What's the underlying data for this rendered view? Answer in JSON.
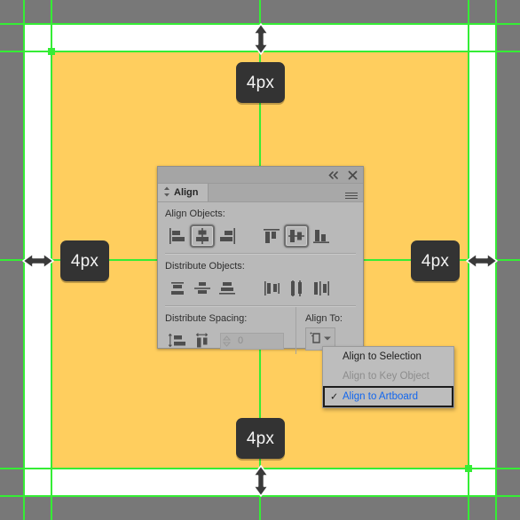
{
  "app": {
    "context": "adobe-illustrator-align-panel",
    "canvas_color": "#787878",
    "artboard_color": "#ffce5e",
    "guide_color": "#35ed35",
    "badge_color": "#333333"
  },
  "spacing_badges": [
    {
      "id": "top",
      "label": "4px"
    },
    {
      "id": "left",
      "label": "4px"
    },
    {
      "id": "right",
      "label": "4px"
    },
    {
      "id": "bottom",
      "label": "4px"
    }
  ],
  "arrows": [
    {
      "id": "top",
      "icon": "double-arrow-vertical-icon"
    },
    {
      "id": "left",
      "icon": "double-arrow-horizontal-icon"
    },
    {
      "id": "right",
      "icon": "double-arrow-horizontal-icon"
    },
    {
      "id": "bottom",
      "icon": "double-arrow-vertical-icon"
    }
  ],
  "panel": {
    "titlebar": {
      "collapse_icon": "double-chevron-left-icon",
      "close_icon": "close-icon"
    },
    "tab": {
      "label": "Align",
      "dock_icon": "up-down-arrows-icon",
      "menu_icon": "hamburger-menu-icon"
    },
    "align_objects": {
      "label": "Align Objects:",
      "buttons": [
        {
          "name": "horizontal-align-left",
          "pressed": false
        },
        {
          "name": "horizontal-align-center",
          "pressed": true
        },
        {
          "name": "horizontal-align-right",
          "pressed": false
        },
        {
          "name": "vertical-align-top",
          "pressed": false
        },
        {
          "name": "vertical-align-center",
          "pressed": true
        },
        {
          "name": "vertical-align-bottom",
          "pressed": false
        }
      ]
    },
    "distribute_objects": {
      "label": "Distribute Objects:",
      "buttons": [
        {
          "name": "vertical-distribute-top"
        },
        {
          "name": "vertical-distribute-center"
        },
        {
          "name": "vertical-distribute-bottom"
        },
        {
          "name": "horizontal-distribute-left"
        },
        {
          "name": "horizontal-distribute-center"
        },
        {
          "name": "horizontal-distribute-right"
        }
      ]
    },
    "distribute_spacing": {
      "label": "Distribute Spacing:",
      "buttons": [
        {
          "name": "vertical-distribute-space"
        },
        {
          "name": "horizontal-distribute-space"
        }
      ],
      "value": "0",
      "stepper_icon": "stepper-arrows-icon"
    },
    "align_to": {
      "label": "Align To:",
      "button_icon": "align-to-artboard-icon",
      "chevron_icon": "chevron-down-icon"
    }
  },
  "dropdown": {
    "items": [
      {
        "label": "Align to Selection",
        "state": "normal",
        "checked": false
      },
      {
        "label": "Align to Key Object",
        "state": "disabled",
        "checked": false
      },
      {
        "label": "Align to Artboard",
        "state": "selected",
        "checked": true,
        "check_glyph": "✓"
      }
    ]
  }
}
